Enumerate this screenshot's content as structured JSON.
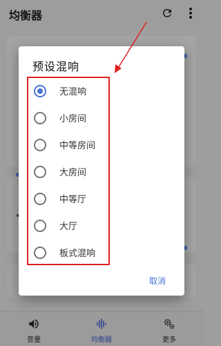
{
  "app": {
    "title": "均衡器",
    "actions": [
      "refresh-icon",
      "more-vertical-icon"
    ]
  },
  "dialog": {
    "title": "预设混响",
    "options": [
      {
        "label": "无混响",
        "checked": true
      },
      {
        "label": "小房间",
        "checked": false
      },
      {
        "label": "中等房间",
        "checked": false
      },
      {
        "label": "大房间",
        "checked": false
      },
      {
        "label": "中等厅",
        "checked": false
      },
      {
        "label": "大厅",
        "checked": false
      },
      {
        "label": "板式混响",
        "checked": false
      }
    ],
    "cancel_label": "取消"
  },
  "bottom_nav": {
    "items": [
      {
        "label": "音量",
        "icon": "volume-icon",
        "active": false
      },
      {
        "label": "均衡器",
        "icon": "equalizer-icon",
        "active": true
      },
      {
        "label": "更多",
        "icon": "settings-gears-icon",
        "active": false
      }
    ]
  },
  "colors": {
    "accent": "#4a73d6",
    "annotation": "#e02020",
    "dim_background": "#9e9e9e"
  }
}
